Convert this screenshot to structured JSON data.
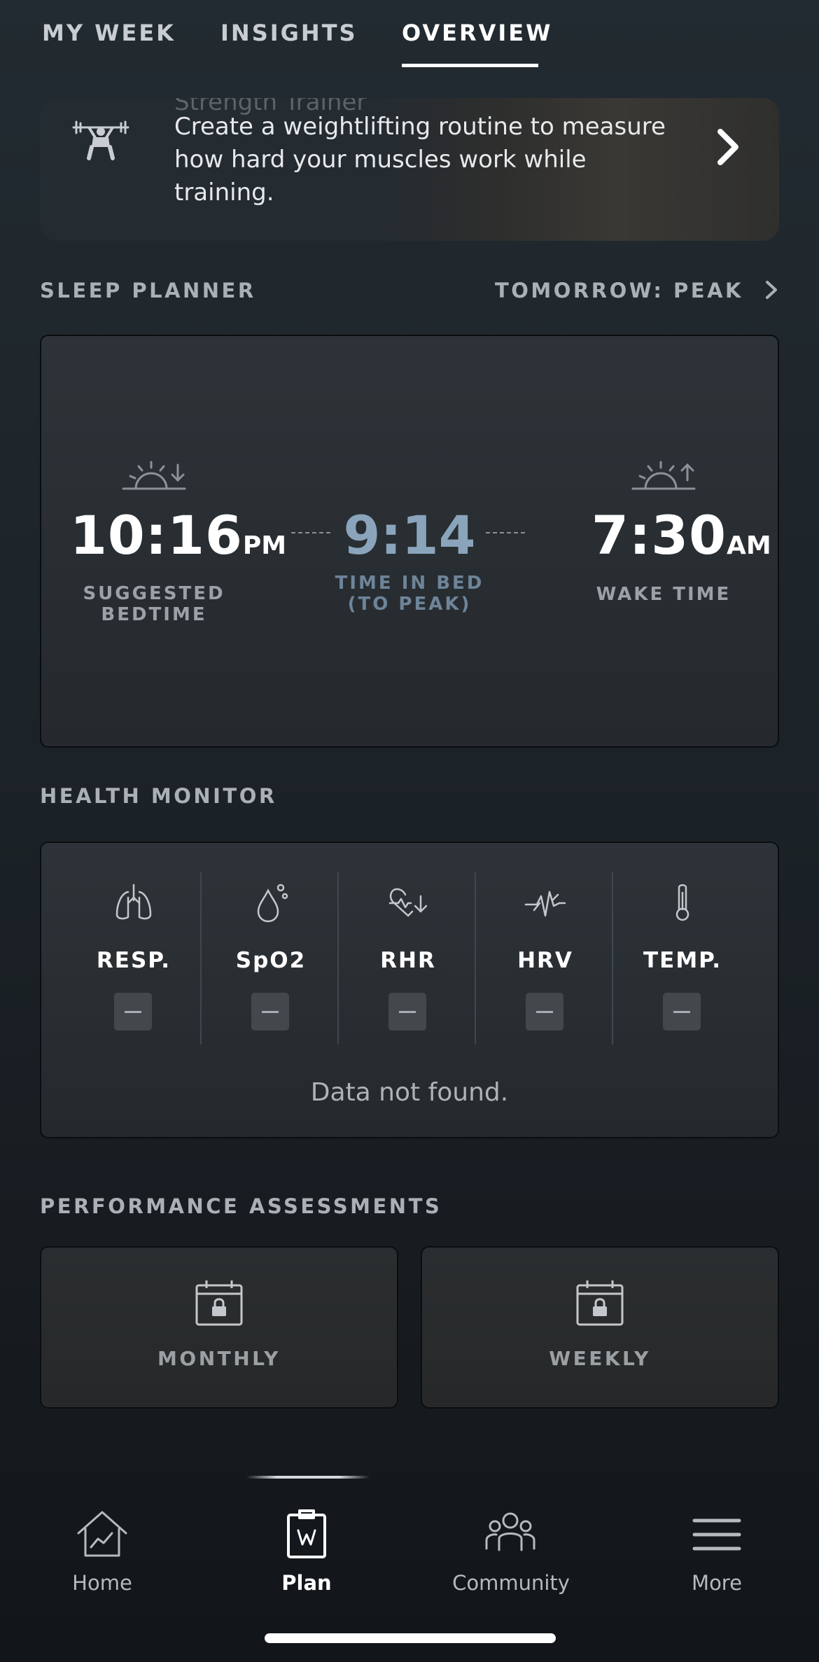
{
  "top_tabs": [
    {
      "label": "MY WEEK",
      "active": false
    },
    {
      "label": "INSIGHTS",
      "active": false
    },
    {
      "label": "OVERVIEW",
      "active": true
    }
  ],
  "promo": {
    "hint_text": "Strength Trainer",
    "text": "Create a weightlifting routine to measure how hard your muscles work while training.",
    "icon": "barbell-icon"
  },
  "sleep_planner": {
    "title": "SLEEP PLANNER",
    "tomorrow": "TOMORROW: PEAK",
    "bedtime": {
      "time": "10:16",
      "suffix": "PM",
      "caption_line1": "SUGGESTED",
      "caption_line2": "BEDTIME",
      "icon": "sunset-icon"
    },
    "time_in_bed": {
      "value": "9:14",
      "caption_line1": "TIME IN BED",
      "caption_line2": "(TO PEAK)"
    },
    "wake": {
      "time": "7:30",
      "suffix": "AM",
      "caption": "WAKE TIME",
      "icon": "sunrise-icon"
    },
    "accent_color": "#8aa4bc"
  },
  "health_monitor": {
    "title": "HEALTH MONITOR",
    "metrics": [
      {
        "label": "RESP.",
        "icon": "lungs-icon"
      },
      {
        "label": "SpO2",
        "icon": "blood-drop-icon"
      },
      {
        "label": "RHR",
        "icon": "heart-rate-down-icon"
      },
      {
        "label": "HRV",
        "icon": "heart-rate-variability-icon"
      },
      {
        "label": "TEMP.",
        "icon": "thermometer-icon"
      }
    ],
    "status": "Data not found."
  },
  "performance_assessments": {
    "title": "PERFORMANCE ASSESSMENTS",
    "items": [
      {
        "label": "MONTHLY",
        "icon": "locked-calendar-icon"
      },
      {
        "label": "WEEKLY",
        "icon": "locked-calendar-icon"
      }
    ]
  },
  "bottom_nav": [
    {
      "label": "Home",
      "icon": "home-chart-icon",
      "active": false
    },
    {
      "label": "Plan",
      "icon": "clipboard-icon",
      "active": true
    },
    {
      "label": "Community",
      "icon": "people-icon",
      "active": false
    },
    {
      "label": "More",
      "icon": "menu-icon",
      "active": false
    }
  ]
}
